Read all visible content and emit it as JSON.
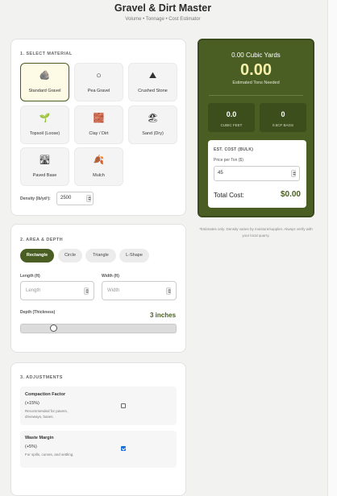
{
  "header": {
    "title": "Gravel & Dirt Master",
    "subtitle": "Volume • Tonnage • Cost Estimator"
  },
  "material": {
    "section_title": "1. SELECT MATERIAL",
    "items": [
      {
        "label": "Standard Gravel",
        "icon": "gravel-pile-icon",
        "glyph": "🪨",
        "selected": true
      },
      {
        "label": "Pea Gravel",
        "icon": "circle-icon",
        "glyph": "○",
        "selected": false
      },
      {
        "label": "Crushed Stone",
        "icon": "mountain-icon",
        "glyph": "⛰",
        "selected": false
      },
      {
        "label": "Topsoil (Loose)",
        "icon": "sprout-icon",
        "glyph": "🌱",
        "selected": false
      },
      {
        "label": "Clay / Dirt",
        "icon": "brick-icon",
        "glyph": "🧱",
        "selected": false
      },
      {
        "label": "Sand (Dry)",
        "icon": "beach-icon",
        "glyph": "🏖",
        "selected": false
      },
      {
        "label": "Paved Base",
        "icon": "road-icon",
        "glyph": "🛣",
        "selected": false
      },
      {
        "label": "Mulch",
        "icon": "leaf-icon",
        "glyph": "🍂",
        "selected": false
      }
    ],
    "density_label": "Density (lb/yd³):",
    "density_value": "2500"
  },
  "area": {
    "section_title": "2. AREA & DEPTH",
    "shapes": [
      {
        "label": "Rectangle",
        "active": true
      },
      {
        "label": "Circle",
        "active": false
      },
      {
        "label": "Triangle",
        "active": false
      },
      {
        "label": "L-Shape",
        "active": false
      }
    ],
    "length_label": "Length (ft)",
    "length_placeholder": "Length",
    "width_label": "Width (ft)",
    "width_placeholder": "Width",
    "depth_label": "Depth (Thickness)",
    "depth_display": "3 inches",
    "depth_inches": 3,
    "depth_slider_fraction": 0.22
  },
  "adjustments": {
    "section_title": "3. ADJUSTMENTS",
    "items": [
      {
        "title": "Compaction Factor",
        "pct": "(+15%)",
        "desc": "Recommended for pavers, driveways, bases.",
        "checked": false
      },
      {
        "title": "Waste Margin",
        "pct": "(+5%)",
        "desc": "For spills, curves, and settling.",
        "checked": true
      }
    ]
  },
  "results": {
    "cubic_yards": "0.00 Cubic Yards",
    "tons": "0.00",
    "tons_label": "Estimated Tons Needed",
    "cubic_feet_value": "0.0",
    "cubic_feet_label": "CUBIC FEET",
    "bags_value": "0",
    "bags_label": "0.5CF BAGS",
    "cost_title": "EST. COST (BULK)",
    "price_label": "Price per Ton ($)",
    "price_value": "45",
    "total_label": "Total Cost:",
    "total_value": "$0.00"
  },
  "disclaimer": "*Estimates only. Density varies by moisture/supplier. Always verify with your local quarry.",
  "colors": {
    "primary": "#4a5e24",
    "accent": "#f6f0a8",
    "checkbox": "#1a6fd8"
  }
}
